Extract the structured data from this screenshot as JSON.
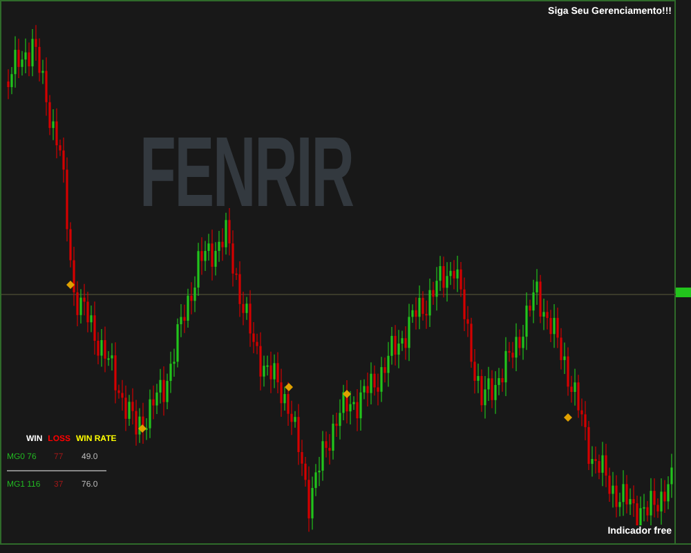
{
  "chart": {
    "watermark": "FENRIR",
    "message": "Siga Seu Gerenciamento!!!",
    "footer": "Indicador free"
  },
  "stats": {
    "columns": [
      {
        "label": "WIN",
        "color": "#ffffff"
      },
      {
        "label": "LOSS",
        "color": "#ff0000"
      },
      {
        "label": "WIN RATE",
        "color": "#ffff00"
      }
    ],
    "rows": [
      {
        "label": "MG0 76",
        "losses": "77",
        "rate": "49.0"
      },
      {
        "label": "MG1 116",
        "losses": "37",
        "rate": "76.0"
      }
    ]
  }
}
